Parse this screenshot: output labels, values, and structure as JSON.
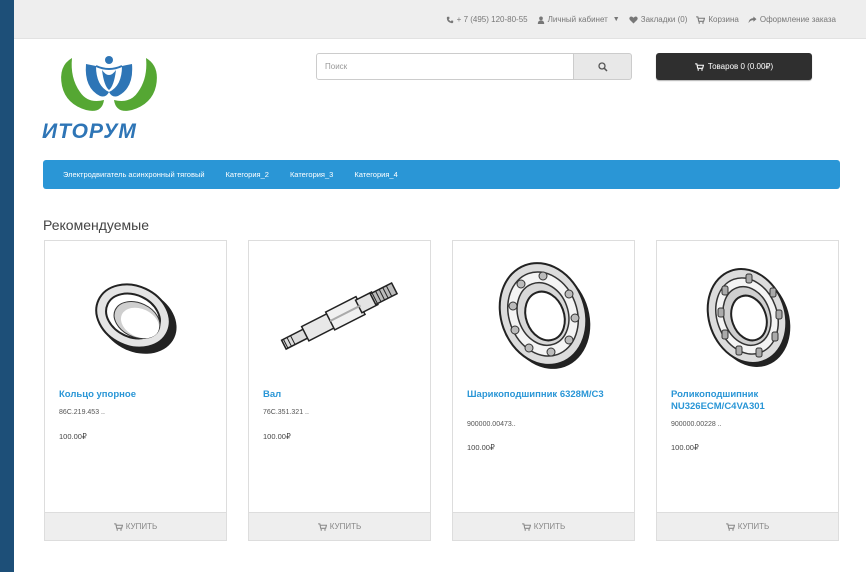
{
  "topbar": {
    "phone": "+ 7 (495) 120-80-55",
    "account": "Личный кабинет",
    "bookmarks": "Закладки (0)",
    "cart": "Корзина",
    "checkout": "Оформление заказа"
  },
  "logo": {
    "text": "ИТОРУМ"
  },
  "search": {
    "placeholder": "Поиск"
  },
  "cart_button": {
    "label": "Товаров 0 (0.00₽)"
  },
  "menu": {
    "items": [
      {
        "label": "Электродвигатель асинхронный тяговый"
      },
      {
        "label": "Категория_2"
      },
      {
        "label": "Категория_3"
      },
      {
        "label": "Категория_4"
      }
    ]
  },
  "section": {
    "title": "Рекомендуемые"
  },
  "products": [
    {
      "name": "Кольцо упорное",
      "sku": "86С.219.453 ..",
      "price": "100.00₽",
      "buy_label": "КУПИТЬ",
      "image": "thrust-ring-image"
    },
    {
      "name": "Вал",
      "sku": "76С.351.321 ..",
      "price": "100.00₽",
      "buy_label": "КУПИТЬ",
      "image": "shaft-image"
    },
    {
      "name": "Шарикоподшипник 6328М/С3",
      "sku": "900000.00473..",
      "price": "100.00₽",
      "buy_label": "КУПИТЬ",
      "image": "ball-bearing-image"
    },
    {
      "name": "Роликоподшипник NU326ECM/C4VA301",
      "sku": "900000.00228 ..",
      "price": "100.00₽",
      "buy_label": "КУПИТЬ",
      "image": "roller-bearing-image"
    }
  ],
  "colors": {
    "menu_bg": "#2a96d6",
    "link": "#2a96d6",
    "logo_green": "#55a733",
    "logo_blue": "#2e75b6",
    "cart_bg": "#2f2f2f"
  }
}
